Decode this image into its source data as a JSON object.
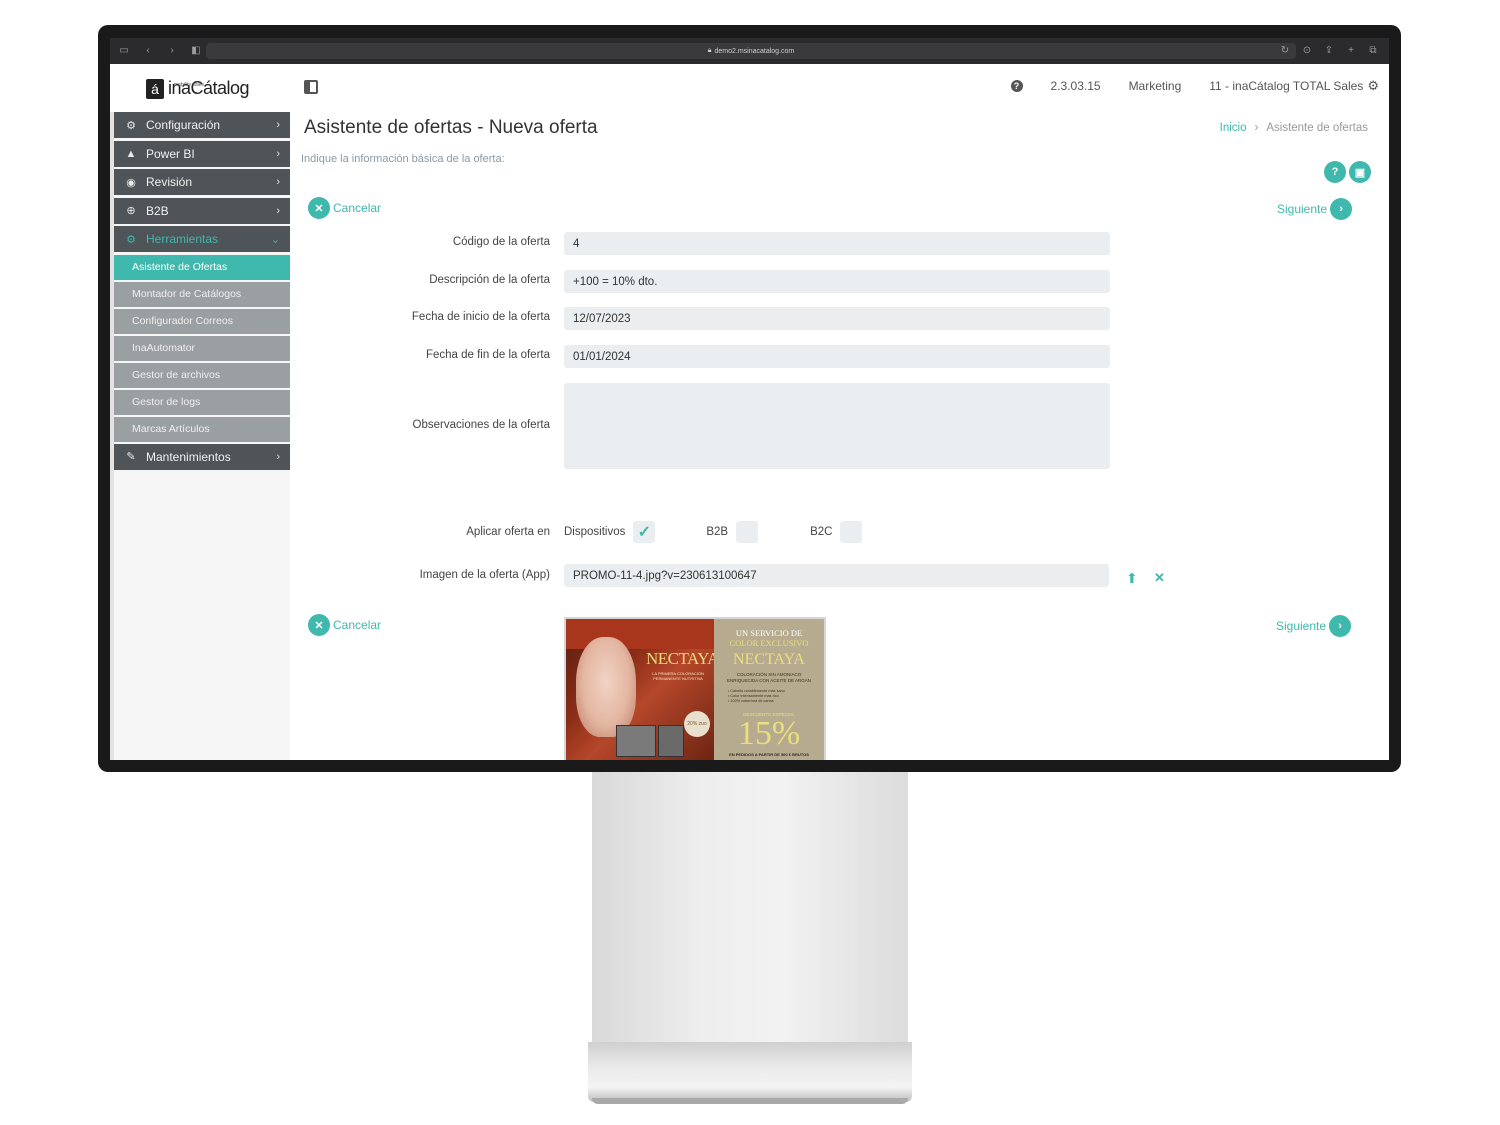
{
  "browser": {
    "url": "demo2.msinacatalog.com"
  },
  "header": {
    "logo_text": "inaCátalog",
    "logo_mark": "á",
    "logo_sub": "mobility sales",
    "help_icon": "question-circle-icon",
    "version": "2.3.03.15",
    "role": "Marketing",
    "company": "11 - inaCátalog TOTAL Sales"
  },
  "sidebar": {
    "items": [
      {
        "label": "Configuración",
        "icon": "gear-icon"
      },
      {
        "label": "Power BI",
        "icon": "triangle-icon"
      },
      {
        "label": "Revisión",
        "icon": "eye-icon"
      },
      {
        "label": "B2B",
        "icon": "globe-icon"
      },
      {
        "label": "Herramientas",
        "icon": "gears-icon"
      },
      {
        "label": "Mantenimientos",
        "icon": "wrench-icon"
      }
    ],
    "subitems": [
      "Asistente de Ofertas",
      "Montador de Catálogos",
      "Configurador Correos",
      "InaAutomator",
      "Gestor de archivos",
      "Gestor de logs",
      "Marcas Artículos"
    ]
  },
  "page": {
    "title": "Asistente de ofertas - Nueva oferta",
    "subtitle": "Indique la información básica de la oferta:",
    "breadcrumb": {
      "home": "Inicio",
      "current": "Asistente de ofertas"
    }
  },
  "actions": {
    "cancel": "Cancelar",
    "next": "Siguiente"
  },
  "form": {
    "code_label": "Código de la oferta",
    "code_value": "4",
    "desc_label": "Descripción de la oferta",
    "desc_value": "+100 = 10% dto.",
    "start_label": "Fecha de inicio de la oferta",
    "start_value": "12/07/2023",
    "end_label": "Fecha de fin de la oferta",
    "end_value": "01/01/2024",
    "notes_label": "Observaciones de la oferta",
    "notes_value": "",
    "apply_label": "Aplicar oferta en",
    "apply": [
      {
        "label": "Dispositivos",
        "checked": true
      },
      {
        "label": "B2B",
        "checked": false
      },
      {
        "label": "B2C",
        "checked": false
      }
    ],
    "image_label": "Imagen de la oferta (App)",
    "image_value": "PROMO-11-4.jpg?v=230613100647"
  },
  "promo": {
    "brand": "NECTAYA",
    "left_sub": "LA PRIMERA COLORACIÓN PERMANENTE NUTRITIVA",
    "badge": "20% zuo",
    "line1": "UN SERVICIO DE",
    "line2": "COLOR EXCLUSIVO",
    "small": "COLORACIÓN SIN AMONIACO ENRIQUECIDA CON ACEITE DE ARGAN",
    "bullets": [
      "• Cabello notablemente más sano",
      "• Color intensamente más rico",
      "• 100% cobertura de canas"
    ],
    "dto": "DESCUENTO ESPECIAL",
    "pct": "15%",
    "foot": "EN PEDIDOS A PARTIR DE 500 € BRUTOS"
  }
}
